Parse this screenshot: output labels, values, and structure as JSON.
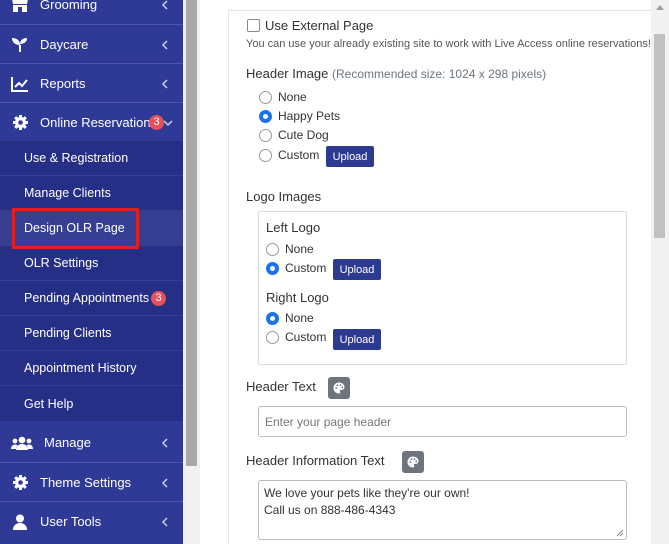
{
  "colors": {
    "sidebar_bg": "#2f3a96",
    "submenu_bg": "#262f86",
    "badge": "#e8505b",
    "upload_button": "#2c3a8f",
    "radio_selected": "#1a73e8",
    "highlight": "#e02020"
  },
  "sidebar": {
    "top_items": [
      {
        "label": "Grooming",
        "icon": "shop-icon"
      },
      {
        "label": "Daycare",
        "icon": "seedling-icon"
      },
      {
        "label": "Reports",
        "icon": "chart-line-icon"
      },
      {
        "label": "Online Reservations",
        "icon": "gear-icon",
        "badge": "3"
      }
    ],
    "submenu": [
      {
        "label": "Use & Registration"
      },
      {
        "label": "Manage Clients"
      },
      {
        "label": "Design OLR Page"
      },
      {
        "label": "OLR Settings"
      },
      {
        "label": "Pending Appointments",
        "badge": "3"
      },
      {
        "label": "Pending Clients"
      },
      {
        "label": "Appointment History"
      },
      {
        "label": "Get Help"
      }
    ],
    "bottom_items": [
      {
        "label": "Manage",
        "icon": "users-icon"
      },
      {
        "label": "Theme Settings",
        "icon": "gear-icon"
      },
      {
        "label": "User Tools",
        "icon": "user-icon"
      }
    ]
  },
  "form": {
    "use_external": {
      "label": "Use External Page",
      "checked": false,
      "help": "You can use your already existing site to work with Live Access online reservations!"
    },
    "header_image": {
      "title": "Header Image",
      "hint": "(Recommended size: 1024 x 298 pixels)",
      "options": [
        "None",
        "Happy Pets",
        "Cute Dog",
        "Custom"
      ],
      "selected": "Happy Pets",
      "upload_label": "Upload"
    },
    "logo_images": {
      "title": "Logo Images",
      "left": {
        "title": "Left Logo",
        "options": [
          "None",
          "Custom"
        ],
        "selected": "Custom",
        "upload_label": "Upload"
      },
      "right": {
        "title": "Right Logo",
        "options": [
          "None",
          "Custom"
        ],
        "selected": "None",
        "upload_label": "Upload"
      }
    },
    "header_text": {
      "title": "Header Text",
      "placeholder": "Enter your page header",
      "value": ""
    },
    "header_info": {
      "title": "Header Information Text",
      "line1": "We love your pets like they're our own!",
      "line2": "Call us on 888-486-4343"
    }
  }
}
